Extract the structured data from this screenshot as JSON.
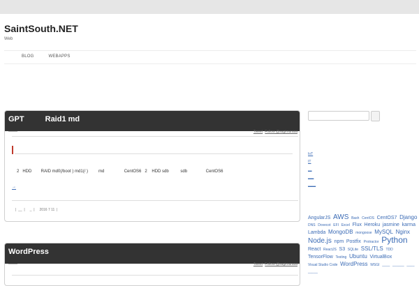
{
  "site": {
    "title": "SaintSouth.NET",
    "description": "Web"
  },
  "nav": {
    "items": [
      "BLOG",
      "WEBAPPS"
    ]
  },
  "posts": [
    {
      "title_left": "GPT",
      "title_right": "Raid1 md",
      "share": {
        "tweet": "Tweet",
        "follow": "Follow @sugimurasa"
      },
      "body": "2   HDD        RAID md0(/boot ) md1(/ )         md                 CentOS6   2    HDD sdb          sdb                CentOS6",
      "readmore": "→",
      "meta": "|  __  |     _  |     2016 7 11  |"
    },
    {
      "title_left": "WordPress",
      "share": {
        "tweet": "Tweet",
        "follow": "Follow @sugimurasa"
      }
    }
  ],
  "sidebar": {
    "links": [
      "IoT",
      "IT",
      "__",
      "___",
      "____"
    ],
    "tags": [
      {
        "t": "AngularJS",
        "s": 2
      },
      {
        "t": "AWS",
        "s": 4
      },
      {
        "t": "Bash",
        "s": 1
      },
      {
        "t": "CentOS",
        "s": 1
      },
      {
        "t": "CentOS7",
        "s": 2
      },
      {
        "t": "Django",
        "s": 3
      },
      {
        "t": "DNS",
        "s": 1
      },
      {
        "t": "Dovecot",
        "s": 1
      },
      {
        "t": "EFI",
        "s": 1
      },
      {
        "t": "Excel",
        "s": 1
      },
      {
        "t": "Flux",
        "s": 2
      },
      {
        "t": "Heroku",
        "s": 2
      },
      {
        "t": "jasmine",
        "s": 2
      },
      {
        "t": "karma",
        "s": 2
      },
      {
        "t": "Lambda",
        "s": 2
      },
      {
        "t": "MongoDB",
        "s": 3
      },
      {
        "t": "mongoose",
        "s": 1
      },
      {
        "t": "MySQL",
        "s": 3
      },
      {
        "t": "Nginx",
        "s": 3
      },
      {
        "t": "Node.js",
        "s": 4
      },
      {
        "t": "npm",
        "s": 2
      },
      {
        "t": "Postfix",
        "s": 2
      },
      {
        "t": "Protractor",
        "s": 1
      },
      {
        "t": "Python",
        "s": 5
      },
      {
        "t": "React",
        "s": 2
      },
      {
        "t": "ReactJS",
        "s": 1
      },
      {
        "t": "S3",
        "s": 2
      },
      {
        "t": "SQLite",
        "s": 1
      },
      {
        "t": "SSL/TLS",
        "s": 3
      },
      {
        "t": "TDD",
        "s": 1
      },
      {
        "t": "TensorFlow",
        "s": 2
      },
      {
        "t": "Testing",
        "s": 1
      },
      {
        "t": "Ubuntu",
        "s": 3
      },
      {
        "t": "VirtualBox",
        "s": 2
      },
      {
        "t": "Visual Studio Code",
        "s": 1
      },
      {
        "t": "WordPress",
        "s": 3
      },
      {
        "t": "WSGI",
        "s": 1
      },
      {
        "t": "____",
        "s": 1
      },
      {
        "t": "______",
        "s": 1
      },
      {
        "t": "____",
        "s": 1
      },
      {
        "t": "_____",
        "s": 1
      }
    ]
  },
  "colors": {
    "header_bg": "#333333",
    "link": "#3b6bb5",
    "accent_red": "#c0392b",
    "topbar": "#e6e6e6"
  }
}
